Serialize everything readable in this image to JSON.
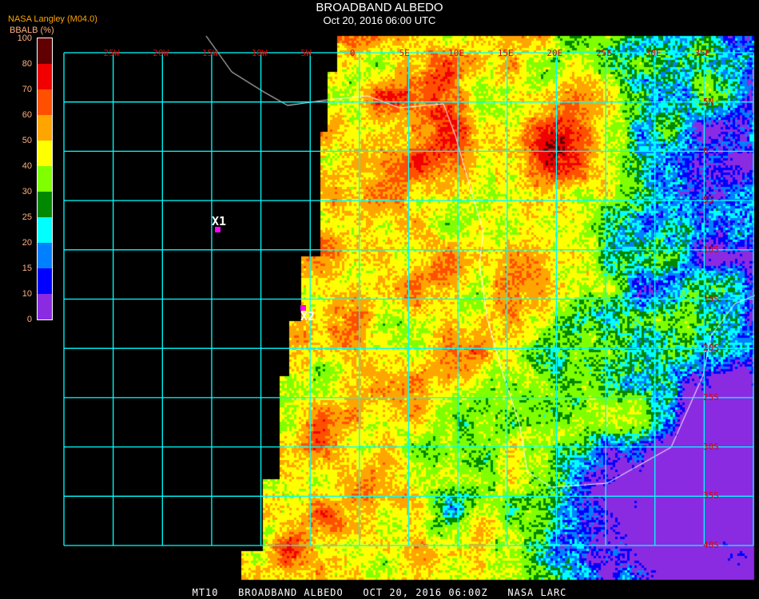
{
  "header": {
    "title": "BROADBAND ALBEDO",
    "subtitle": "Oct 20, 2016 06:00 UTC",
    "source": "NASA Langley (M04.0)",
    "unit_label": "BBALB (%)"
  },
  "legend": {
    "labels": [
      "100",
      "80",
      "70",
      "60",
      "50",
      "40",
      "30",
      "25",
      "20",
      "15",
      "10",
      "0"
    ],
    "colors": [
      "#600000",
      "#f00000",
      "#ff5000",
      "#ffa500",
      "#ffff00",
      "#80ff00",
      "#008800",
      "#00ffff",
      "#0080ff",
      "#0000ff",
      "#8a2be2"
    ]
  },
  "grid": {
    "lon_labels": [
      "25W",
      "20W",
      "15W",
      "10W",
      "5W",
      "0",
      "5E",
      "10E",
      "15E",
      "20E",
      "25E",
      "30E",
      "35E"
    ],
    "lat_labels": [
      "5N",
      "0",
      "5S",
      "10S",
      "15S",
      "20S",
      "25S",
      "30S",
      "35S",
      "40S"
    ],
    "line_color": "#00ffff",
    "label_color": "#e00000"
  },
  "markers": [
    {
      "label": "X1"
    },
    {
      "label": "X2"
    }
  ],
  "footer": "MT10   BROADBAND ALBEDO   OCT 20, 2016 06:00Z   NASA LARC"
}
